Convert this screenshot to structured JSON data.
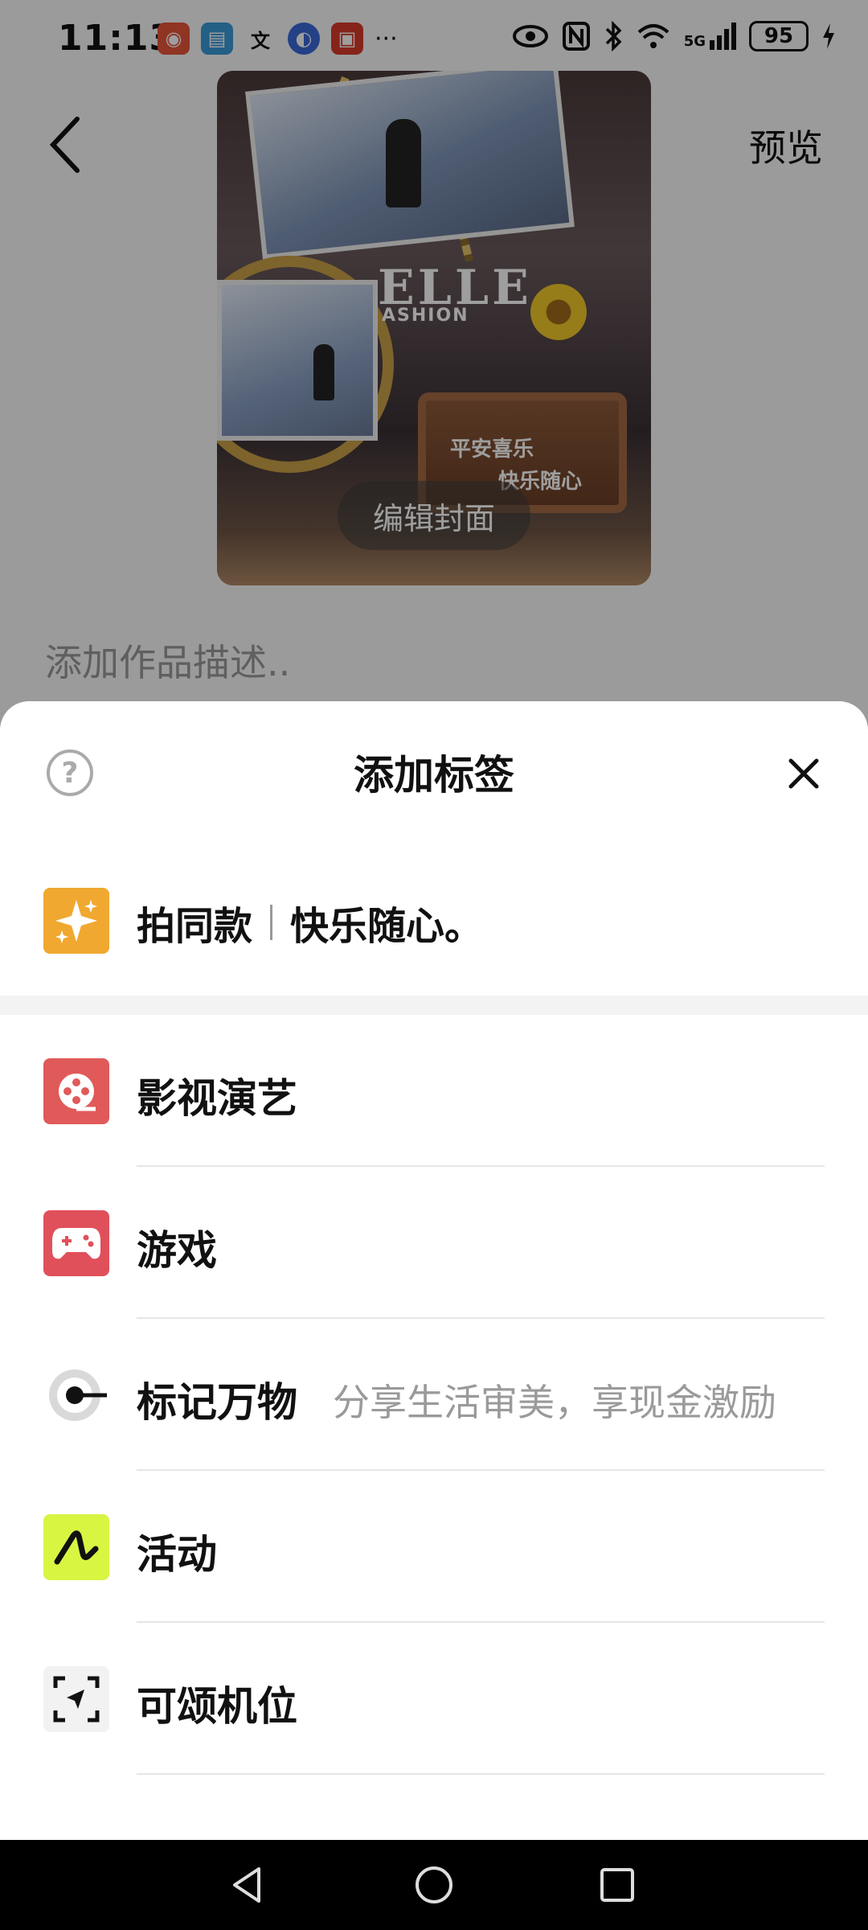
{
  "status_bar": {
    "time": "11:13",
    "battery": "95",
    "network": "5G"
  },
  "nav": {
    "preview_label": "预览"
  },
  "cover": {
    "edit_cover_label": "编辑封面",
    "art_text_elle": "ELLE",
    "art_text_fashion": "ASHION",
    "art_plank_line1": "平安喜乐",
    "art_plank_line2": "快乐随心"
  },
  "description": {
    "placeholder": "添加作品描述.."
  },
  "sheet": {
    "title": "添加标签",
    "help_icon": "question-icon",
    "close_icon": "close-icon",
    "same_style": {
      "label": "拍同款",
      "song": "快乐随心。",
      "icon": "sparkle-icon",
      "icon_color": "#f0a830"
    },
    "items": [
      {
        "label": "影视演艺",
        "icon": "film-reel-icon",
        "icon_color": "#e05a5a",
        "subtitle": ""
      },
      {
        "label": "游戏",
        "icon": "gamepad-icon",
        "icon_color": "#e0505a",
        "subtitle": ""
      },
      {
        "label": "标记万物",
        "icon": "mark-pin-icon",
        "icon_color": "#d9d9d9",
        "subtitle": "分享生活审美，享现金激励"
      },
      {
        "label": "活动",
        "icon": "activity-icon",
        "icon_color": "#d8f542",
        "subtitle": ""
      },
      {
        "label": "可颂机位",
        "icon": "camera-position-icon",
        "icon_color": "#f2f2f2",
        "subtitle": ""
      }
    ]
  }
}
